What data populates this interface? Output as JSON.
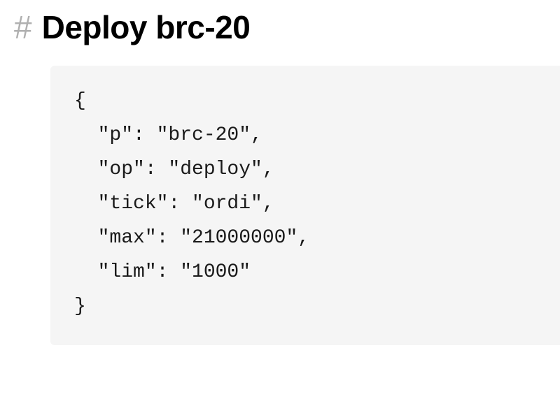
{
  "heading": {
    "prefix": "#",
    "text": "Deploy brc-20"
  },
  "code": "{ \n  \"p\": \"brc-20\",\n  \"op\": \"deploy\",\n  \"tick\": \"ordi\",\n  \"max\": \"21000000\",\n  \"lim\": \"1000\"\n}"
}
